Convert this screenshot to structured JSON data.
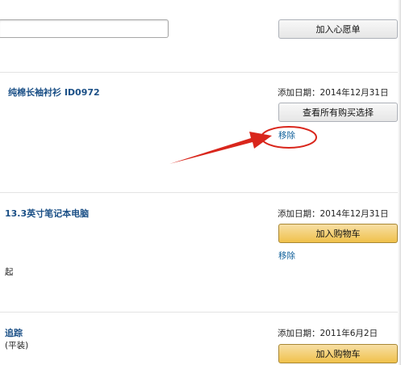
{
  "top": {
    "search_value": "",
    "wishlist_button": "加入心愿单"
  },
  "items": [
    {
      "title": "纯棉长袖衬衫 ID0972",
      "date_label": "添加日期：",
      "date": "2014年12月31日",
      "action_button": "查看所有购买选择",
      "remove_link": "移除",
      "extra": ""
    },
    {
      "title": "13.3英寸笔记本电脑",
      "date_label": "添加日期：",
      "date": "2014年12月31日",
      "action_button": "加入购物车",
      "remove_link": "移除",
      "extra": "起"
    },
    {
      "title": "追踪",
      "subtitle": "(平装)",
      "date_label": "添加日期：",
      "date": "2011年6月2日",
      "action_button": "加入购物车"
    }
  ],
  "annotation": {
    "color": "#d9261c",
    "shape": "arrow pointing to circled remove link"
  }
}
